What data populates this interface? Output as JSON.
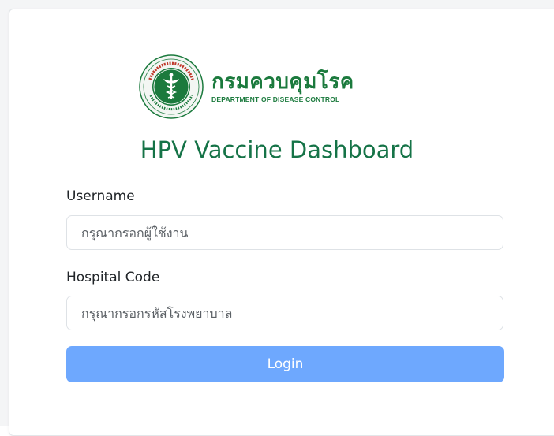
{
  "header": {
    "org_name_thai": "กรมควบคุมโรค",
    "org_name_en": "DEPARTMENT OF DISEASE CONTROL",
    "seal_icon": "ministry-of-public-health-seal",
    "title": "HPV Vaccine Dashboard"
  },
  "form": {
    "username": {
      "label": "Username",
      "placeholder": "กรุณากรอกผู้ใช้งาน",
      "value": ""
    },
    "hospital_code": {
      "label": "Hospital Code",
      "placeholder": "กรุณากรอกรหัสโรงพยาบาล",
      "value": ""
    },
    "login_label": "Login"
  },
  "colors": {
    "brand_green": "#1b7a3d",
    "title_green": "#157347",
    "button_blue": "#6ea8fe"
  }
}
